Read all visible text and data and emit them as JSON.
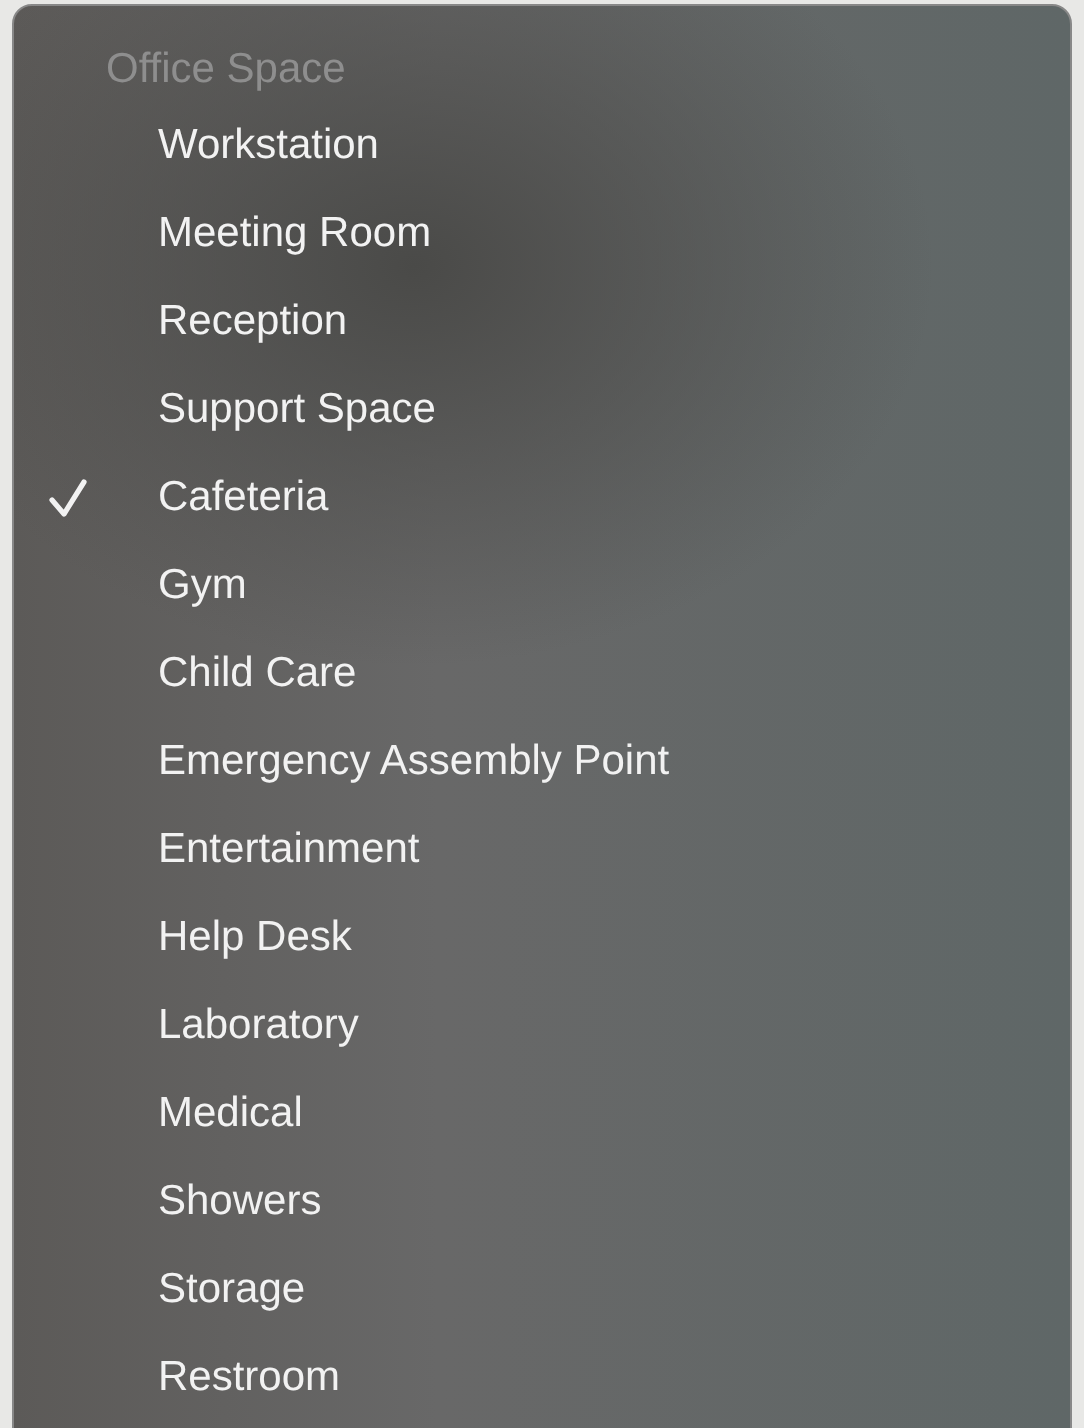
{
  "menu": {
    "header": "Office Space",
    "items": [
      {
        "label": "Workstation",
        "selected": false
      },
      {
        "label": "Meeting Room",
        "selected": false
      },
      {
        "label": "Reception",
        "selected": false
      },
      {
        "label": "Support Space",
        "selected": false
      },
      {
        "label": "Cafeteria",
        "selected": true
      },
      {
        "label": "Gym",
        "selected": false
      },
      {
        "label": "Child Care",
        "selected": false
      },
      {
        "label": "Emergency Assembly Point",
        "selected": false
      },
      {
        "label": "Entertainment",
        "selected": false
      },
      {
        "label": "Help Desk",
        "selected": false
      },
      {
        "label": "Laboratory",
        "selected": false
      },
      {
        "label": "Medical",
        "selected": false
      },
      {
        "label": "Showers",
        "selected": false
      },
      {
        "label": "Storage",
        "selected": false
      },
      {
        "label": "Restroom",
        "selected": false
      }
    ]
  }
}
